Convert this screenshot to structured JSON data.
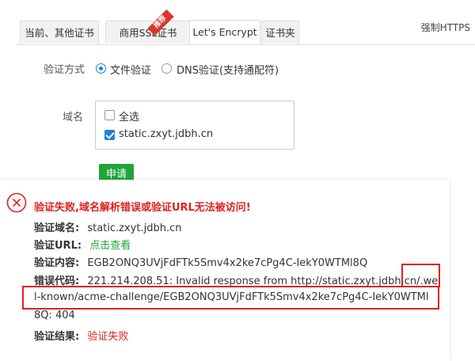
{
  "tabs": [
    {
      "label": "当前、其他证书"
    },
    {
      "label": "商用SSL证书"
    },
    {
      "label": "Let's Encrypt"
    },
    {
      "label": "证书夹"
    }
  ],
  "ribbon": "推荐",
  "force_https": "强制HTTPS",
  "verify": {
    "label": "验证方式",
    "options": [
      {
        "label": "文件验证",
        "selected": true
      },
      {
        "label": "DNS验证(支持通配符)",
        "selected": false
      }
    ]
  },
  "domain": {
    "label": "域名",
    "select_all": "全选",
    "items": [
      {
        "label": "static.zxyt.jdbh.cn",
        "checked": true
      }
    ]
  },
  "apply_label": "申请",
  "error": {
    "title": "验证失败,域名解析错误或验证URL无法被访问!",
    "rows": [
      {
        "key": "验证域名:",
        "value": "static.zxyt.jdbh.cn"
      },
      {
        "key": "验证URL:",
        "value": "点击查看"
      },
      {
        "key": "验证内容:",
        "value": "EGB2ONQ3UVjFdFTk5Smv4x2ke7cPg4C-IekY0WTMl8Q"
      },
      {
        "key": "错误代码:",
        "value": "221.214.208.51: Invalid response from http://static.zxyt.jdbh.cn/.wel"
      },
      {
        "key": "",
        "value": "l-known/acme-challenge/EGB2ONQ3UVjFdFTk5Smv4x2ke7cPg4C-IekY0WTMl"
      },
      {
        "key": "",
        "value": "8Q: 404"
      },
      {
        "key": "验证结果:",
        "value": "验证失败"
      }
    ]
  },
  "colors": {
    "accent_green": "#20a53a",
    "error_red": "#e02020",
    "radio_blue": "#1e7fd8"
  }
}
